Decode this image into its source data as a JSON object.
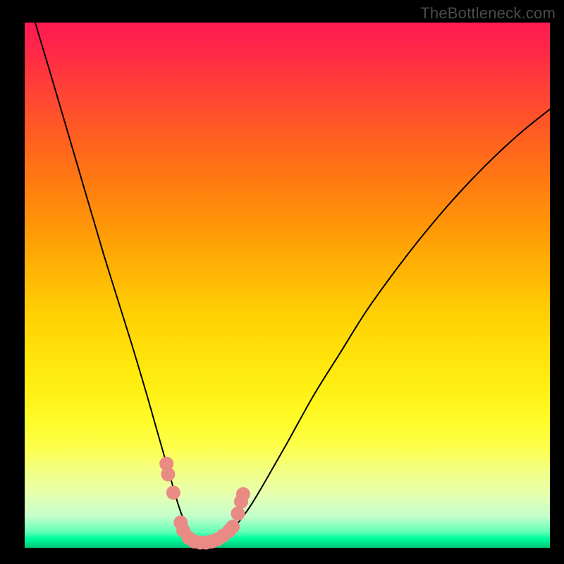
{
  "watermark": "TheBottleneck.com",
  "chart_data": {
    "type": "line",
    "title": "",
    "xlabel": "",
    "ylabel": "",
    "xlim": [
      0,
      100
    ],
    "ylim": [
      0,
      100
    ],
    "series": [
      {
        "name": "bottleneck-curve",
        "x": [
          2,
          5,
          10,
          15,
          20,
          23,
          25,
          27,
          29,
          30,
          31,
          32,
          33,
          34,
          35,
          36,
          38,
          40,
          43,
          46,
          50,
          55,
          60,
          65,
          70,
          75,
          80,
          85,
          90,
          95,
          100
        ],
        "values": [
          100,
          90,
          73,
          56,
          40,
          30,
          23,
          16,
          9,
          6,
          3.5,
          2,
          1.3,
          1,
          1,
          1.3,
          2.2,
          4,
          8,
          13,
          20,
          29,
          37,
          45,
          52,
          58.5,
          64.5,
          70,
          75,
          79.5,
          83.5
        ]
      }
    ],
    "markers": {
      "name": "highlight-dots",
      "color": "#e98a84",
      "points": [
        {
          "x": 27.0,
          "y": 16
        },
        {
          "x": 27.3,
          "y": 14
        },
        {
          "x": 28.3,
          "y": 10.5
        },
        {
          "x": 29.7,
          "y": 4.8
        },
        {
          "x": 30.2,
          "y": 3.3
        },
        {
          "x": 31.2,
          "y": 1.9
        },
        {
          "x": 32.3,
          "y": 1.2
        },
        {
          "x": 33.4,
          "y": 1.0
        },
        {
          "x": 34.5,
          "y": 1.0
        },
        {
          "x": 35.6,
          "y": 1.2
        },
        {
          "x": 36.7,
          "y": 1.6
        },
        {
          "x": 37.8,
          "y": 2.3
        },
        {
          "x": 38.9,
          "y": 3.2
        },
        {
          "x": 39.6,
          "y": 4.0
        },
        {
          "x": 40.6,
          "y": 6.5
        },
        {
          "x": 41.2,
          "y": 8.8
        },
        {
          "x": 41.6,
          "y": 10.2
        }
      ]
    },
    "gradient_stops": [
      {
        "pos": 0,
        "color": "#ff1a52"
      },
      {
        "pos": 50,
        "color": "#ffd400"
      },
      {
        "pos": 85,
        "color": "#f5ff80"
      },
      {
        "pos": 100,
        "color": "#00d884"
      }
    ]
  }
}
